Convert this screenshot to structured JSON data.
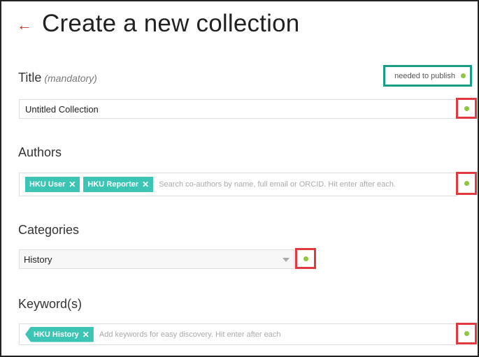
{
  "header": {
    "back_icon": "left-arrow-icon",
    "title": "Create a new collection"
  },
  "publish_legend": {
    "label": "needed to publish",
    "dot_color": "#8dc63f",
    "box_color": "#1a9c85"
  },
  "title_field": {
    "label": "Title",
    "hint": "(mandatory)",
    "value": "Untitled Collection"
  },
  "authors_field": {
    "label": "Authors",
    "tags": [
      "HKU User",
      "HKU Reporter"
    ],
    "placeholder": "Search co-authors by name, full email or ORCID. Hit enter after each."
  },
  "categories_field": {
    "label": "Categories",
    "selected": "History"
  },
  "keywords_field": {
    "label": "Keyword(s)",
    "tags": [
      "HKU History"
    ],
    "placeholder": "Add keywords for easy discovery. Hit enter after each"
  },
  "colors": {
    "accent_red": "#c0392b",
    "tag_teal": "#3cc4b4",
    "highlight_red": "#e0393e"
  }
}
